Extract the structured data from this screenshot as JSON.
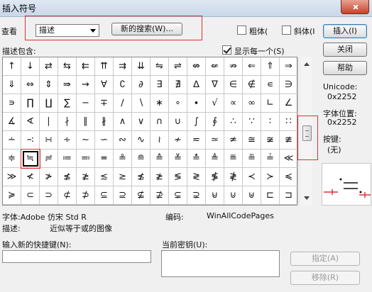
{
  "window": {
    "title": "插入符号"
  },
  "top": {
    "view_label": "查看",
    "view_value": "描述",
    "search_button": "新的搜索(W)...",
    "bold_label": "粗体(",
    "italic_label": "斜体(I"
  },
  "buttons": {
    "insert": "插入(I)",
    "close": "关闭",
    "help": "帮助",
    "assign": "指定(A)",
    "remove": "移除(R)"
  },
  "grid": {
    "desc_label": "描述包含:",
    "show_each_label": "显示每一个(S)",
    "selected_index": 81,
    "symbols": [
      "↑",
      "↓",
      "⇄",
      "⇆",
      "⇇",
      "⇈",
      "⇉",
      "⇊",
      "⇋",
      "⇌",
      "⇎",
      "⇍",
      "⇏",
      "⇐",
      "⇑",
      "⇒",
      "⇓",
      "⇔",
      "⇕",
      "⇛",
      "⇝",
      "∀",
      "∁",
      "∂",
      "∃",
      "∄",
      "∆",
      "∇",
      "∈",
      "∉",
      "∊",
      "∋",
      "∍",
      "∏",
      "∐",
      "∑",
      "−",
      "∓",
      "∕",
      "∖",
      "∗",
      "∘",
      "∙",
      "√",
      "∝",
      "∞",
      "∟",
      "∠",
      "∡",
      "∢",
      "∣",
      "∤",
      "∥",
      "∦",
      "∧",
      "∨",
      "∩",
      "∪",
      "∫",
      "∮",
      "∴",
      "∵",
      "∶",
      "∷",
      "∸",
      "∹",
      "∺",
      "∻",
      "∼",
      "∽",
      "∾",
      "∿",
      "≀",
      "≁",
      "≂",
      "≃",
      "≄",
      "≅",
      "≆",
      "≇",
      "≑",
      "≒",
      "≓",
      "≔",
      "≕",
      "≖",
      "≗",
      "≘",
      "≙",
      "≚",
      "≛",
      "≜",
      "≝",
      "≞",
      "≟",
      "≪",
      "≫",
      "≮",
      "≯",
      "≰",
      "≱",
      "≲",
      "≳",
      "≴",
      "≵",
      "≶",
      "≷",
      "≸",
      "≹",
      "≺",
      "≻",
      "≼",
      "≽",
      "⊂",
      "⊃",
      "⊄",
      "⊅",
      "⊆",
      "⊇",
      "⊈",
      "⊉",
      "⊊",
      "⊋",
      "⊌",
      "⊍",
      "⊎",
      "⊏",
      "⊐"
    ]
  },
  "info": {
    "unicode_label": "Unicode:",
    "unicode_value": "0x2252",
    "charpos_label": "字体位置:",
    "charpos_value": "0x2252",
    "key_label": "按键:",
    "key_value": "(无)",
    "font_line": "字体:Adobe 仿宋 Std R",
    "encoding_label": "编码:",
    "encoding_value": "WinAllCodePages",
    "desc_label": "描述:",
    "desc_value": "近似等于或的图像"
  },
  "shortcut": {
    "new_label": "输入新的快捷键(N):",
    "current_label": "当前密钥(U):"
  },
  "colors": {
    "highlight": "#e03030"
  }
}
